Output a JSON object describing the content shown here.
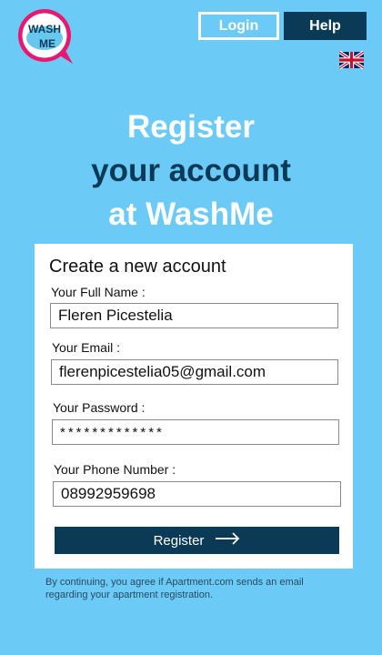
{
  "logo": {
    "text": "WASH ME",
    "ring_color": "#e8186f",
    "fill_color": "#68c7ef"
  },
  "header": {
    "login_label": "Login",
    "help_label": "Help",
    "language_icon": "uk-flag-icon"
  },
  "hero": {
    "line1": "Register",
    "line2": "your account",
    "line3": "at WashMe"
  },
  "form": {
    "title": "Create a new account",
    "full_name_label": "Your Full Name :",
    "full_name_value": "Fleren Picestelia",
    "email_label": "Your Email :",
    "email_value": "flerenpicestelia05@gmail.com",
    "password_label": "Your Password :",
    "password_value": "*************",
    "phone_label": "Your Phone Number :",
    "phone_value": "08992959698",
    "submit_label": "Register",
    "submit_icon": "arrow-right-icon"
  },
  "footer": {
    "note": "By continuing, you agree if Apartment.com sends an email regarding your apartment registration."
  },
  "colors": {
    "background": "#6ccaf6",
    "primary": "#0b3a57",
    "white": "#ffffff"
  }
}
